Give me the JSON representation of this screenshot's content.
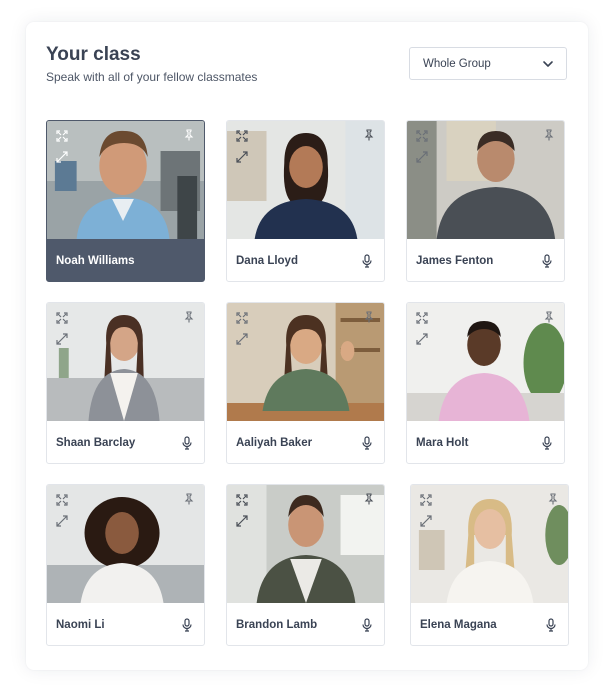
{
  "header": {
    "title": "Your class",
    "subtitle": "Speak with all of your fellow classmates"
  },
  "group_select": {
    "selected": "Whole Group",
    "icon": "chevron-down-icon"
  },
  "colors": {
    "active_tile": "#4f596b",
    "text": "#3a4354",
    "border": "#e2e5ea"
  },
  "participants": [
    {
      "name": "Noah Williams",
      "active": true,
      "mic_icon": "none"
    },
    {
      "name": "Dana Lloyd",
      "active": false,
      "mic_icon": "microphone-icon"
    },
    {
      "name": "James Fenton",
      "active": false,
      "mic_icon": "microphone-icon"
    },
    {
      "name": "Shaan Barclay",
      "active": false,
      "mic_icon": "microphone-icon"
    },
    {
      "name": "Aaliyah Baker",
      "active": false,
      "mic_icon": "microphone-icon"
    },
    {
      "name": "Mara Holt",
      "active": false,
      "mic_icon": "microphone-icon"
    },
    {
      "name": "Naomi Li",
      "active": false,
      "mic_icon": "microphone-icon"
    },
    {
      "name": "Brandon Lamb",
      "active": false,
      "mic_icon": "microphone-icon"
    },
    {
      "name": "Elena Magana",
      "active": false,
      "mic_icon": "microphone-icon"
    }
  ]
}
